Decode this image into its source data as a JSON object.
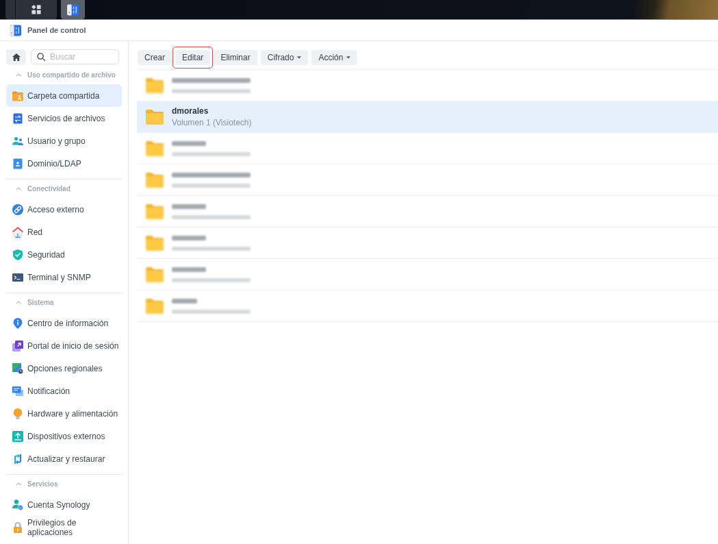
{
  "taskbar": {
    "buttons": [
      {
        "selected": false
      },
      {
        "selected": true
      }
    ]
  },
  "window": {
    "title": "Panel de control"
  },
  "sidebar": {
    "search": {
      "placeholder": "Buscar"
    },
    "sections": [
      {
        "title": "Uso compartido de archivo",
        "expanded": true,
        "items": [
          {
            "label": "Carpeta compartida",
            "selected": true
          },
          {
            "label": "Servicios de archivos",
            "selected": false
          },
          {
            "label": "Usuario y grupo",
            "selected": false
          },
          {
            "label": "Dominio/LDAP",
            "selected": false
          }
        ]
      },
      {
        "title": "Conectividad",
        "expanded": true,
        "items": [
          {
            "label": "Acceso externo",
            "selected": false
          },
          {
            "label": "Red",
            "selected": false
          },
          {
            "label": "Seguridad",
            "selected": false
          },
          {
            "label": "Terminal y SNMP",
            "selected": false
          }
        ]
      },
      {
        "title": "Sistema",
        "expanded": true,
        "items": [
          {
            "label": "Centro de información",
            "selected": false
          },
          {
            "label": "Portal de inicio de sesión",
            "selected": false
          },
          {
            "label": "Opciones regionales",
            "selected": false
          },
          {
            "label": "Notificación",
            "selected": false
          },
          {
            "label": "Hardware y alimentación",
            "selected": false
          },
          {
            "label": "Dispositivos externos",
            "selected": false
          },
          {
            "label": "Actualizar y restaurar",
            "selected": false
          }
        ]
      },
      {
        "title": "Servicios",
        "expanded": true,
        "items": [
          {
            "label": "Cuenta Synology",
            "selected": false
          },
          {
            "label": "Privilegios de aplicaciones",
            "selected": false
          }
        ]
      }
    ]
  },
  "toolbar": {
    "buttons": [
      {
        "label": "Crear",
        "dropdown": false,
        "highlighted": false
      },
      {
        "label": "Editar",
        "dropdown": false,
        "highlighted": true
      },
      {
        "label": "Eliminar",
        "dropdown": false,
        "highlighted": false
      },
      {
        "label": "Cifrado",
        "dropdown": true,
        "highlighted": false
      },
      {
        "label": "Acción",
        "dropdown": true,
        "highlighted": false
      }
    ]
  },
  "shared_folders": {
    "rows": [
      {
        "kind": "blurred",
        "selected": false
      },
      {
        "kind": "folder",
        "name": "dmorales",
        "detail": "Volumen 1 (Visiotech)",
        "selected": true
      },
      {
        "kind": "blurred",
        "selected": false
      },
      {
        "kind": "blurred",
        "selected": false
      },
      {
        "kind": "blurred",
        "selected": false
      },
      {
        "kind": "blurred",
        "selected": false
      },
      {
        "kind": "blurred",
        "selected": false
      },
      {
        "kind": "blurred",
        "selected": false
      }
    ]
  }
}
